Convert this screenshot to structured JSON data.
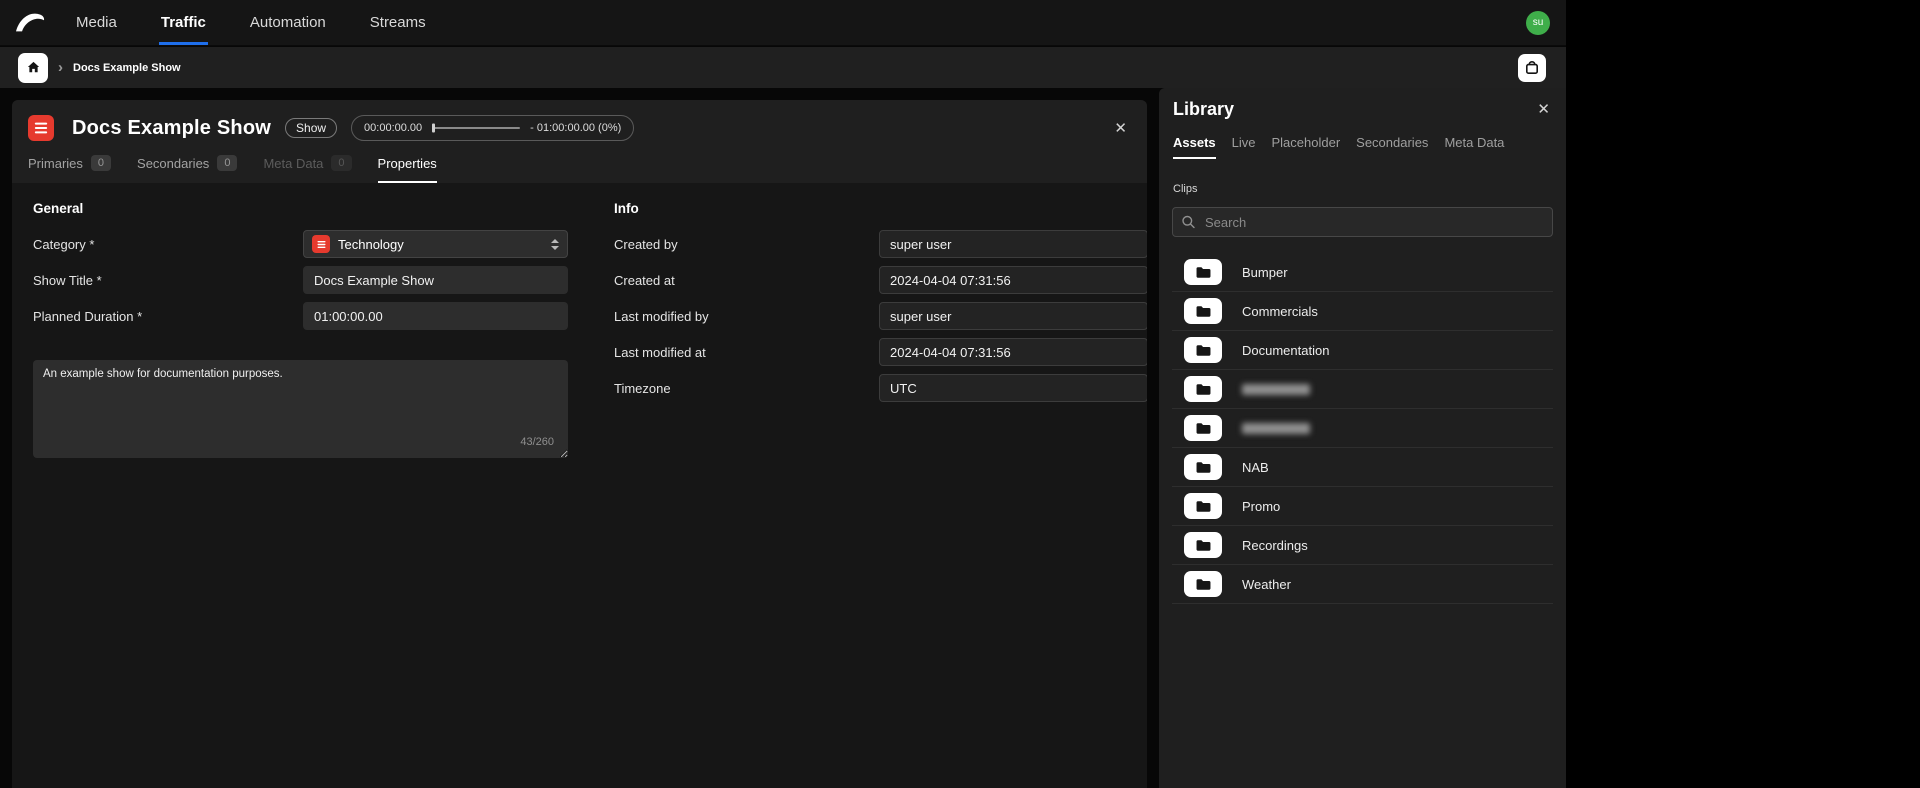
{
  "icons": {
    "close": "✕",
    "chevron_right": "›"
  },
  "topnav": {
    "items": [
      {
        "label": "Media"
      },
      {
        "label": "Traffic",
        "active": true
      },
      {
        "label": "Automation"
      },
      {
        "label": "Streams"
      }
    ],
    "avatar": "su"
  },
  "breadcrumb": {
    "current": "Docs Example Show"
  },
  "show_panel": {
    "title": "Docs Example Show",
    "type_badge": "Show",
    "progress": {
      "elapsed": "00:00:00.00",
      "remaining": "- 01:00:00.00 (0%)",
      "percent": 0
    },
    "tabs": [
      {
        "label": "Primaries",
        "count": "0"
      },
      {
        "label": "Secondaries",
        "count": "0"
      },
      {
        "label": "Meta Data",
        "count": "0",
        "disabled": true
      },
      {
        "label": "Properties",
        "active": true
      }
    ],
    "general": {
      "heading": "General",
      "category_label": "Category *",
      "category_value": "Technology",
      "show_title_label": "Show Title *",
      "show_title_value": "Docs Example Show",
      "planned_duration_label": "Planned Duration *",
      "planned_duration_value": "01:00:00.00",
      "description_value": "An example show for documentation purposes.",
      "char_counter": "43/260"
    },
    "info": {
      "heading": "Info",
      "rows": [
        {
          "label": "Created by",
          "value": "super user"
        },
        {
          "label": "Created at",
          "value": "2024-04-04 07:31:56"
        },
        {
          "label": "Last modified by",
          "value": "super user"
        },
        {
          "label": "Last modified at",
          "value": "2024-04-04 07:31:56"
        },
        {
          "label": "Timezone",
          "value": "UTC"
        }
      ]
    }
  },
  "library": {
    "title": "Library",
    "tabs": [
      {
        "label": "Assets",
        "active": true
      },
      {
        "label": "Live"
      },
      {
        "label": "Placeholder"
      },
      {
        "label": "Secondaries"
      },
      {
        "label": "Meta Data"
      }
    ],
    "section_label": "Clips",
    "search_placeholder": "Search",
    "folders": [
      {
        "label": "Bumper"
      },
      {
        "label": "Commercials"
      },
      {
        "label": "Documentation"
      },
      {
        "label": "",
        "blurred": true
      },
      {
        "label": "",
        "blurred": true
      },
      {
        "label": "NAB"
      },
      {
        "label": "Promo"
      },
      {
        "label": "Recordings"
      },
      {
        "label": "Weather"
      }
    ]
  }
}
